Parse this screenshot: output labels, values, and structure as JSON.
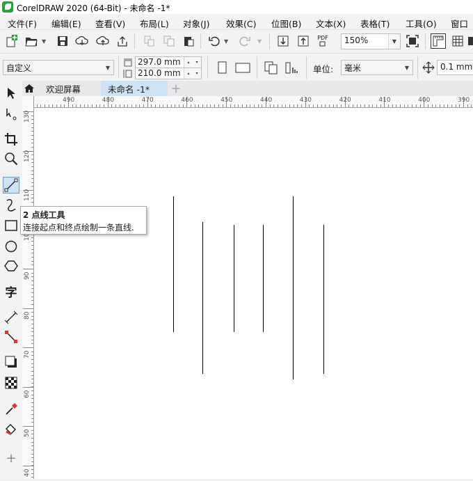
{
  "window": {
    "title": "CorelDRAW 2020 (64-Bit) - 未命名 -1*"
  },
  "menu": [
    {
      "label": "文件(F)"
    },
    {
      "label": "编辑(E)"
    },
    {
      "label": "查看(V)"
    },
    {
      "label": "布局(L)"
    },
    {
      "label": "对象(J)"
    },
    {
      "label": "效果(C)"
    },
    {
      "label": "位图(B)"
    },
    {
      "label": "文本(X)"
    },
    {
      "label": "表格(T)"
    },
    {
      "label": "工具(O)"
    },
    {
      "label": "窗口"
    }
  ],
  "toolbar": {
    "zoom_value": "150%",
    "pdf_label": "PDF"
  },
  "property_bar": {
    "page_preset": "自定义",
    "width_value": "297.0 mm",
    "height_value": "210.0 mm",
    "unit_label": "单位:",
    "unit_value": "毫米",
    "nudge_value": "0.1 mm"
  },
  "tabs": [
    {
      "label": "欢迎屏幕"
    },
    {
      "label": "未命名 -1*"
    }
  ],
  "ruler": {
    "h_labels": [
      "490",
      "480",
      "470",
      "460",
      "450",
      "440",
      "430",
      "420",
      "410",
      "400",
      "390"
    ],
    "v_labels": [
      "130",
      "120",
      "110",
      "100",
      "90",
      "80",
      "70",
      "60",
      "50",
      "40"
    ]
  },
  "tooltip": {
    "title": "2 点线工具",
    "description": "连接起点和终点绘制一条直线."
  },
  "toolbox": {
    "text_tool_glyph": "字"
  },
  "colors": {
    "accent": "#2e9e3e",
    "active_tab": "#cfe3f7",
    "tool_active": "#cde4f8"
  }
}
